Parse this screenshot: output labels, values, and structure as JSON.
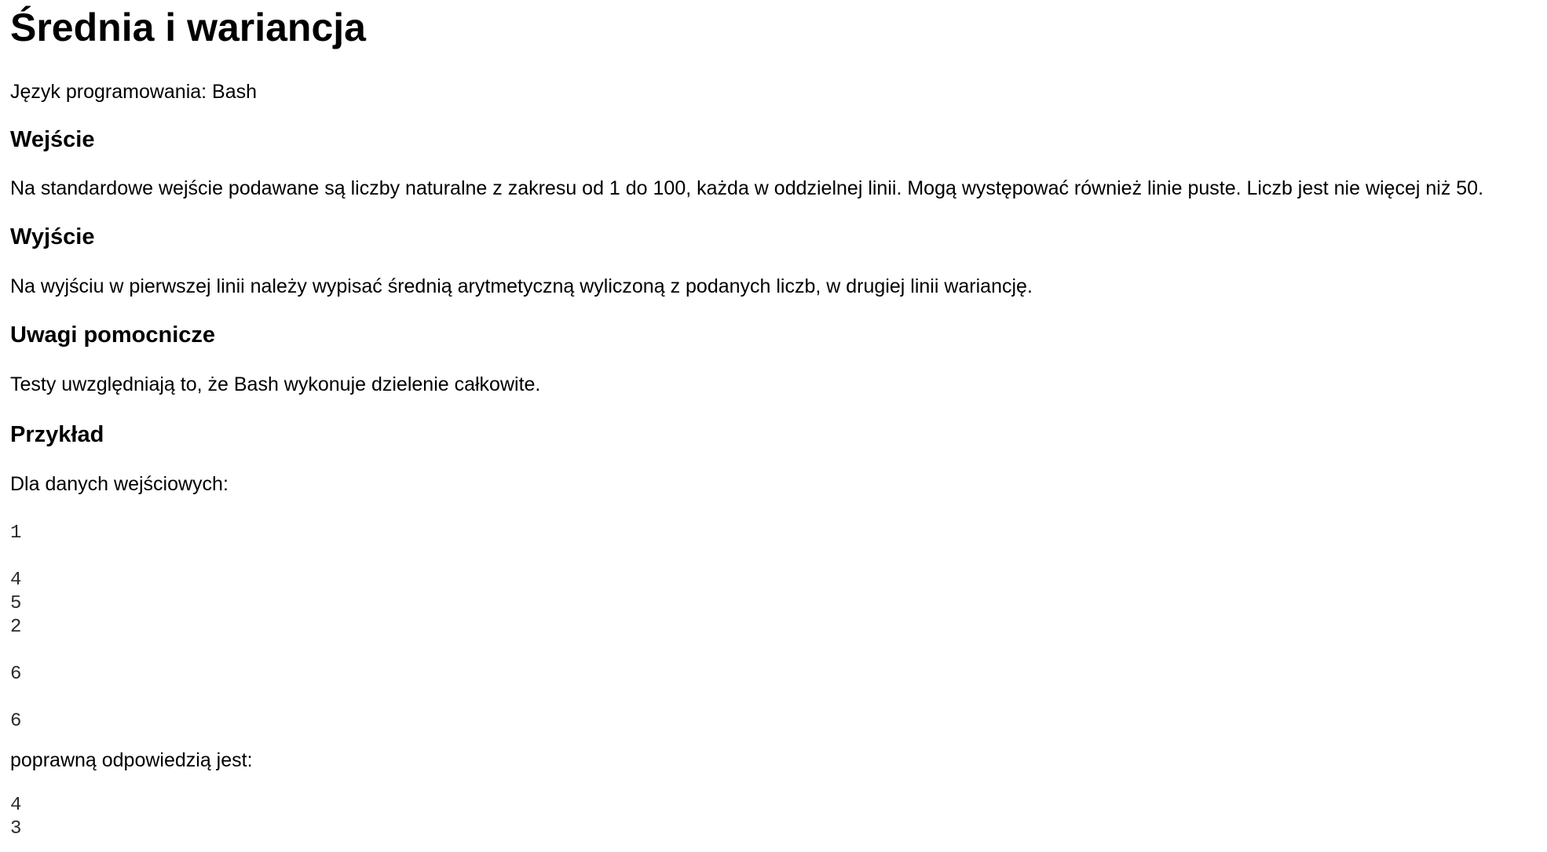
{
  "title": "Średnia i wariancja",
  "language_line": "Język programowania: Bash",
  "sections": {
    "input": {
      "heading": "Wejście",
      "text": "Na standardowe wejście podawane są liczby naturalne z zakresu od 1 do 100, każda w oddzielnej linii. Mogą występować również linie puste. Liczb jest nie więcej niż 50."
    },
    "output": {
      "heading": "Wyjście",
      "text": "Na wyjściu w pierwszej linii należy wypisać średnią arytmetyczną wyliczoną z podanych liczb, w drugiej linii wariancję."
    },
    "notes": {
      "heading": "Uwagi pomocnicze",
      "text": "Testy uwzględniają to, że Bash wykonuje dzielenie całkowite."
    },
    "example": {
      "heading": "Przykład",
      "input_intro": "Dla danych wejściowych:",
      "input_data": "1\n\n4\n5\n2\n\n6\n\n6",
      "answer_intro": "poprawną odpowiedzią jest:",
      "output_data": "4\n3"
    }
  }
}
